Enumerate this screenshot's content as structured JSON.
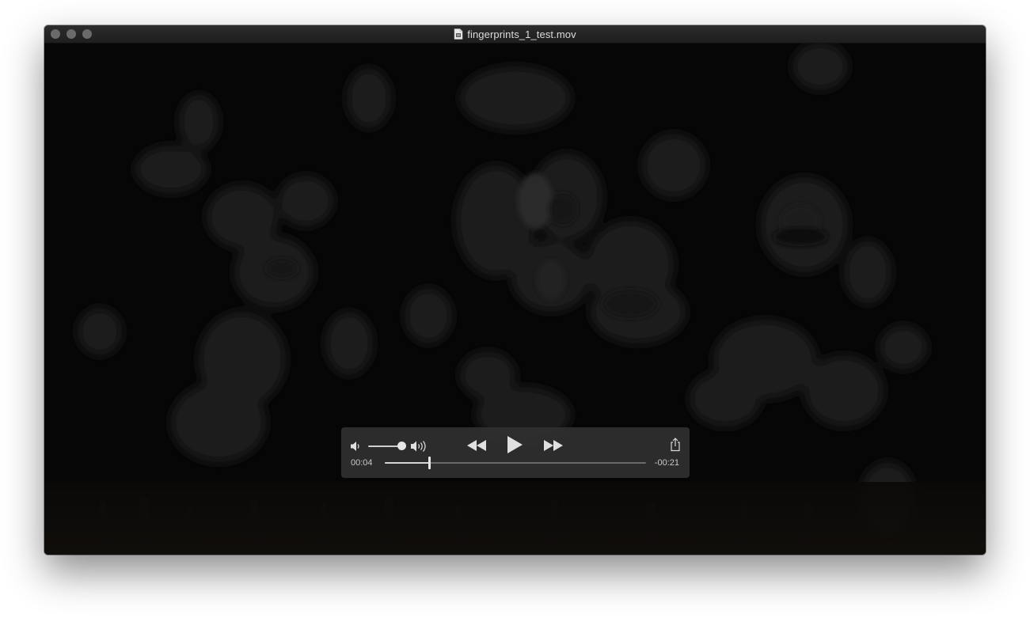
{
  "window": {
    "title": "fingerprints_1_test.mov",
    "file_icon": "document-icon"
  },
  "controls": {
    "volume_low_icon": "speaker-low-icon",
    "volume_high_icon": "speaker-high-icon",
    "volume_level": 0.9,
    "rewind_icon": "rewind-icon",
    "play_icon": "play-icon",
    "fast_forward_icon": "fast-forward-icon",
    "share_icon": "share-icon",
    "time_current": "00:04",
    "time_remaining": "-00:21",
    "progress": 0.17
  },
  "colors": {
    "titlebar": "#262626",
    "video_background": "#050505",
    "hud_background": "#303030",
    "control_foreground": "#e0e0e0"
  }
}
